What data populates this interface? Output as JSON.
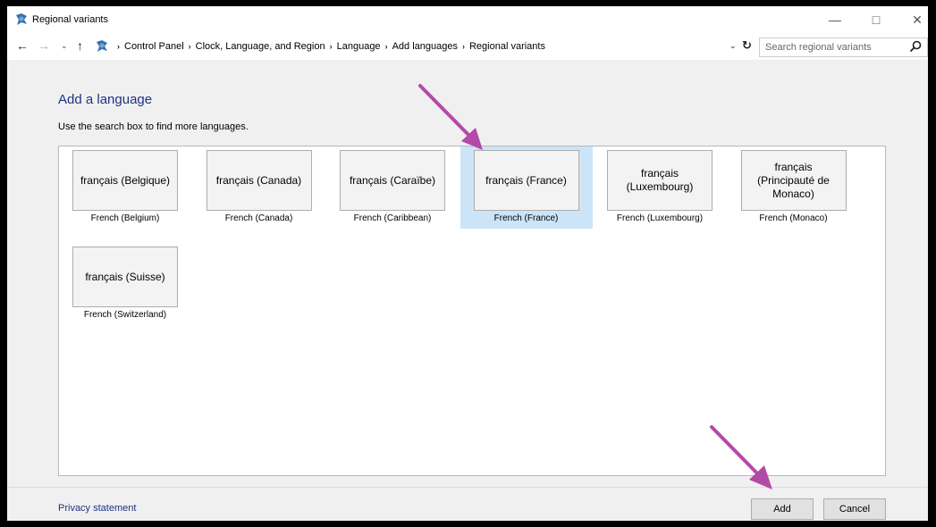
{
  "window": {
    "title": "Regional variants"
  },
  "navbar": {
    "breadcrumbs": [
      "Control Panel",
      "Clock, Language, and Region",
      "Language",
      "Add languages",
      "Regional variants"
    ],
    "search_placeholder": "Search regional variants"
  },
  "content": {
    "heading": "Add a language",
    "subtext": "Use the search box to find more languages.",
    "tiles": [
      {
        "native": "français (Belgique)",
        "english": "French (Belgium)",
        "selected": false
      },
      {
        "native": "français (Canada)",
        "english": "French (Canada)",
        "selected": false
      },
      {
        "native": "français (Caraïbe)",
        "english": "French (Caribbean)",
        "selected": false
      },
      {
        "native": "français (France)",
        "english": "French (France)",
        "selected": true
      },
      {
        "native": "français (Luxembourg)",
        "english": "French (Luxembourg)",
        "selected": false
      },
      {
        "native": "français (Principauté de Monaco)",
        "english": "French (Monaco)",
        "selected": false
      },
      {
        "native": "français (Suisse)",
        "english": "French (Switzerland)",
        "selected": false
      }
    ]
  },
  "footer": {
    "privacy_label": "Privacy statement",
    "add_label": "Add",
    "cancel_label": "Cancel"
  },
  "colors": {
    "selection": "#cce4f7",
    "link": "#1e3287",
    "annotation_arrow": "#b44aa8"
  }
}
